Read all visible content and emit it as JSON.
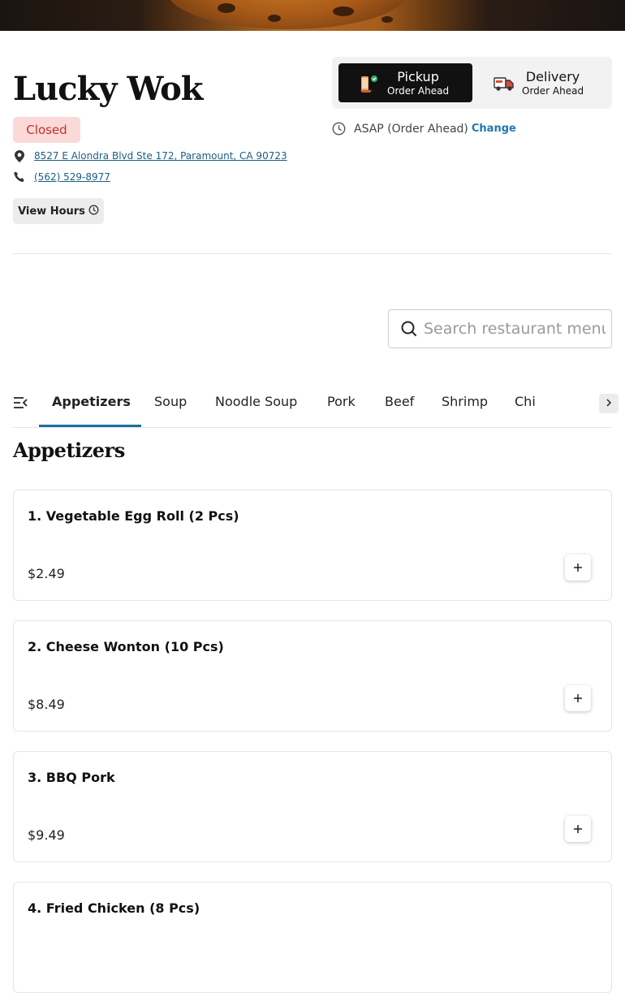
{
  "restaurant": {
    "name": "Lucky Wok",
    "status": "Closed",
    "address": "8527 E Alondra Blvd Ste 172, Paramount, CA 90723",
    "phone": "(562) 529-8977",
    "hours_button": "View Hours"
  },
  "order_mode": {
    "pickup": {
      "label": "Pickup",
      "sub": "Order Ahead",
      "selected": true
    },
    "delivery": {
      "label": "Delivery",
      "sub": "Order Ahead",
      "selected": false
    },
    "timing": "ASAP (Order Ahead)",
    "change_label": "Change"
  },
  "search": {
    "placeholder": "Search restaurant menu"
  },
  "categories": {
    "tabs": [
      "Appetizers",
      "Soup",
      "Noodle Soup",
      "Pork",
      "Beef",
      "Shrimp",
      "Chi"
    ],
    "active": "Appetizers"
  },
  "section": {
    "title": "Appetizers"
  },
  "items": [
    {
      "name": "1. Vegetable Egg Roll (2 Pcs)",
      "price": "$2.49"
    },
    {
      "name": "2. Cheese Wonton (10 Pcs)",
      "price": "$8.49"
    },
    {
      "name": "3. BBQ Pork",
      "price": "$9.49"
    },
    {
      "name": "4. Fried Chicken (8 Pcs)",
      "price": ""
    }
  ],
  "colors": {
    "accent": "#1f6fa0",
    "link": "#1b5f84",
    "closed_bg": "#fbd9d9",
    "closed_text": "#c4302b",
    "pickup_bg": "#111111"
  },
  "icons": [
    "map-pin-icon",
    "phone-icon",
    "clock-icon",
    "pickup-icon",
    "delivery-truck-icon",
    "search-icon",
    "menu-list-icon",
    "chevron-right-icon",
    "plus-icon"
  ]
}
